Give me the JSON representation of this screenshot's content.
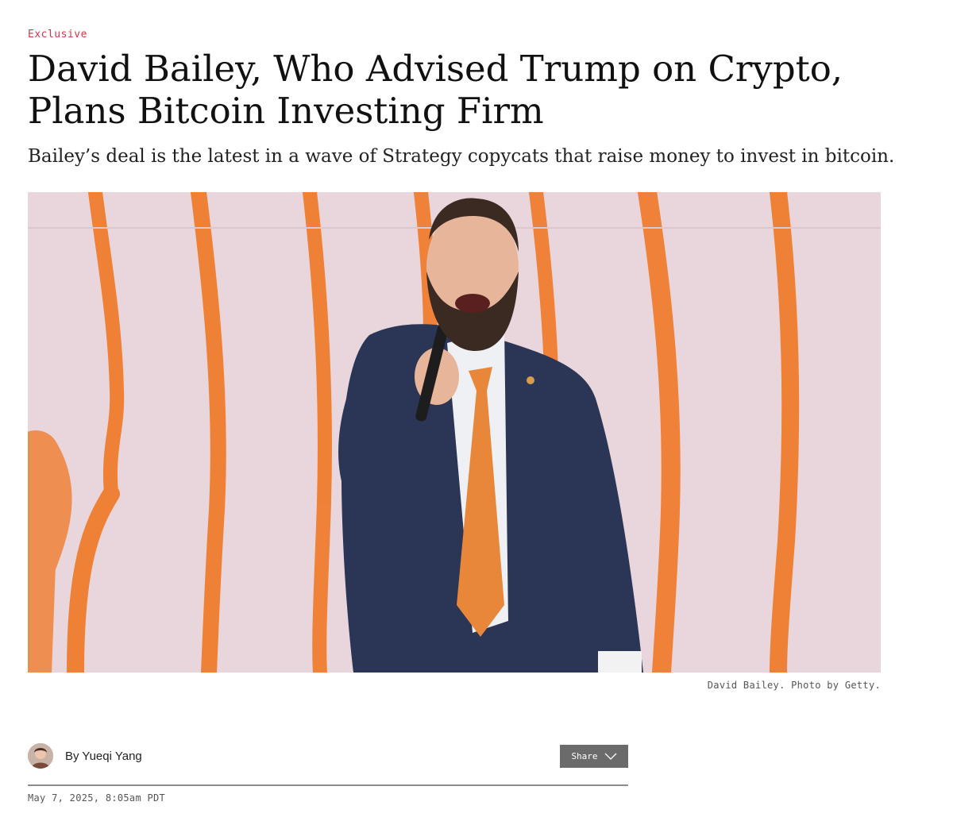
{
  "article": {
    "kicker": "Exclusive",
    "headline": "David Bailey, Who Advised Trump on Crypto, Plans Bitcoin Investing Firm",
    "dek": "Bailey’s deal is the latest in a wave of Strategy copycats that raise money to invest in bitcoin.",
    "caption": "David Bailey. Photo by Getty.",
    "byline": "By Yueqi Yang",
    "share_label": "Share",
    "dateline": "May 7, 2025, 8:05am PDT"
  },
  "colors": {
    "kicker": "#d2354a",
    "hero_background": "#e9d6dc",
    "hero_stripes": "#f07a2a",
    "share_button": "#6b6b6b"
  },
  "icons": {
    "share": "chevron-down-icon"
  }
}
